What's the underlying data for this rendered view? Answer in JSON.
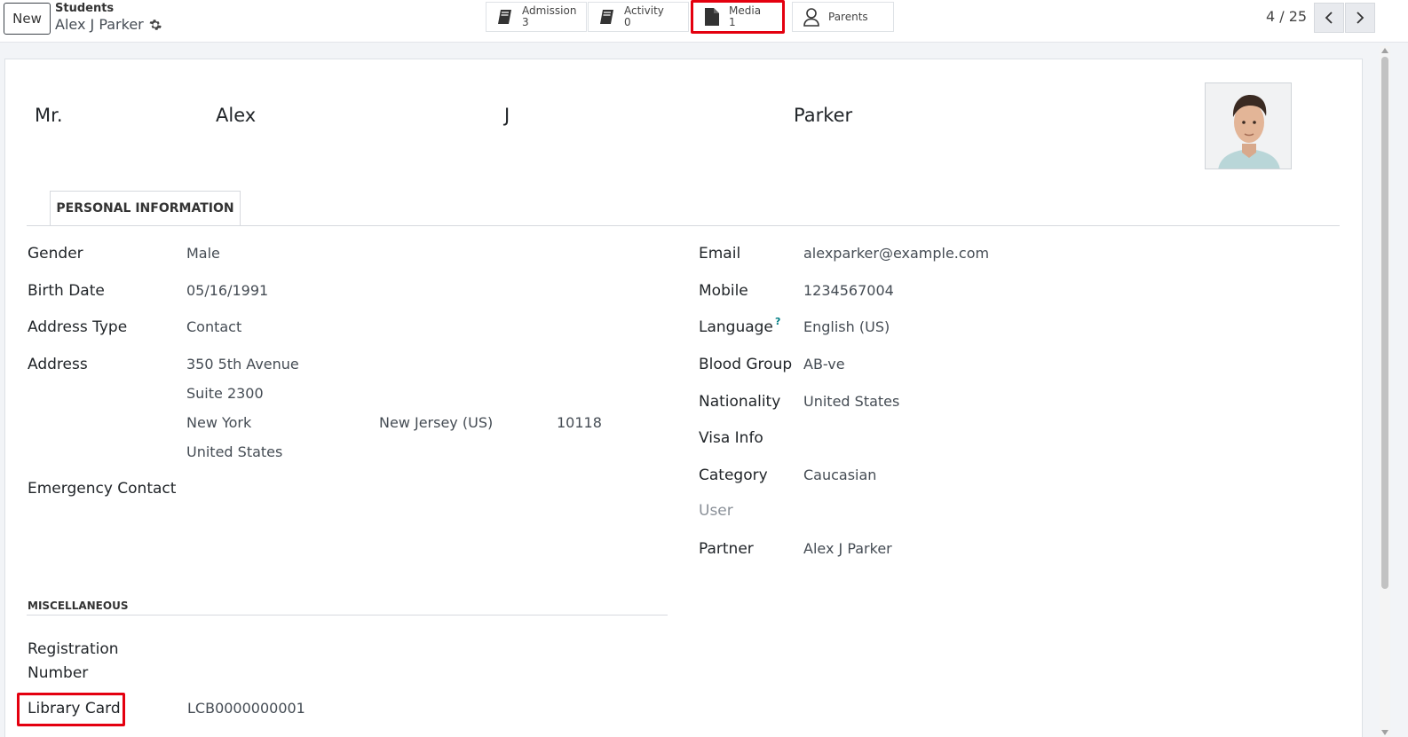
{
  "controls": {
    "new_label": "New",
    "breadcrumb_parent": "Students",
    "breadcrumb_current": "Alex J Parker"
  },
  "smart_buttons": {
    "admission": {
      "label": "Admission",
      "count": "3"
    },
    "activity": {
      "label": "Activity",
      "count": "0"
    },
    "media": {
      "label": "Media",
      "count": "1"
    },
    "parents": {
      "label": "Parents"
    }
  },
  "pager": {
    "value": "4 / 25"
  },
  "student": {
    "title": "Mr.",
    "first_name": "Alex",
    "middle_name": "J",
    "last_name": "Parker"
  },
  "tabs": {
    "personal": "PERSONAL INFORMATION"
  },
  "left_fields": {
    "gender": {
      "label": "Gender",
      "value": "Male"
    },
    "birth_date": {
      "label": "Birth Date",
      "value": "05/16/1991"
    },
    "address_type": {
      "label": "Address Type",
      "value": "Contact"
    },
    "address": {
      "label": "Address",
      "street": "350 5th Avenue",
      "street2": "Suite 2300",
      "city": "New York",
      "state": "New Jersey (US)",
      "zip": "10118",
      "country": "United States"
    },
    "emergency": {
      "label": "Emergency Contact"
    }
  },
  "right_fields": {
    "email": {
      "label": "Email",
      "value": "alexparker@example.com"
    },
    "mobile": {
      "label": "Mobile",
      "value": "1234567004"
    },
    "language": {
      "label": "Language",
      "help": "?",
      "value": "English (US)"
    },
    "blood_group": {
      "label": "Blood Group",
      "value": "AB-ve"
    },
    "nationality": {
      "label": "Nationality",
      "value": "United States"
    },
    "visa": {
      "label": "Visa Info"
    },
    "category": {
      "label": "Category",
      "value": "Caucasian"
    },
    "user": {
      "label": "User"
    },
    "partner": {
      "label": "Partner",
      "value": "Alex J Parker"
    }
  },
  "misc": {
    "title": "MISCELLANEOUS",
    "registration_line1": "Registration",
    "registration_line2": "Number",
    "library_label": "Library Card",
    "library_value": "LCB0000000001"
  },
  "colors": {
    "highlight": "#e4000f",
    "accent": "#017e84"
  }
}
